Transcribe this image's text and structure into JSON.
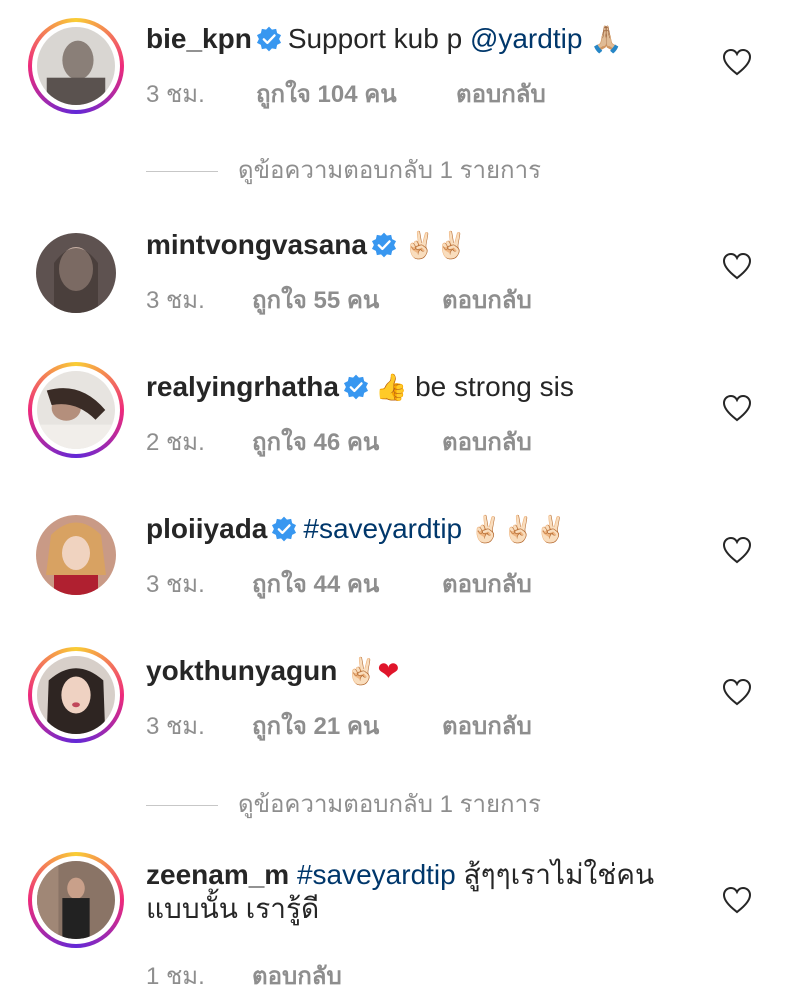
{
  "comments": [
    {
      "username": "bie_kpn",
      "verified": true,
      "text": "Support kub p ",
      "mention": "@yardtip",
      "emoji": "🙏🏼",
      "time": "3 ชม.",
      "likes": "ถูกใจ 104 คน",
      "reply": "ตอบกลับ"
    },
    {
      "username": "mintvongvasana",
      "verified": true,
      "emoji": "✌🏻✌🏻",
      "time": "3 ชม.",
      "likes": "ถูกใจ 55 คน",
      "reply": "ตอบกลับ"
    },
    {
      "username": "realyingrhatha",
      "verified": true,
      "emoji": "👍",
      "text": " be strong sis",
      "time": "2 ชม.",
      "likes": "ถูกใจ 46 คน",
      "reply": "ตอบกลับ"
    },
    {
      "username": "ploiiyada",
      "verified": true,
      "hashtag": "#saveyardtip",
      "emoji": "✌🏻✌🏻✌🏻",
      "time": "3 ชม.",
      "likes": "ถูกใจ 44 คน",
      "reply": "ตอบกลับ"
    },
    {
      "username": "yokthunyagun",
      "verified": false,
      "emoji": "✌🏻",
      "emoji2": "❤",
      "time": "3 ชม.",
      "likes": "ถูกใจ 21 คน",
      "reply": "ตอบกลับ"
    },
    {
      "username": "zeenam_m",
      "verified": false,
      "hashtag": "#saveyardtip",
      "text": " สู้ๆๆเราไม่ใช่คนแบบนั้น เรารู้ดี",
      "time": "1 ชม.",
      "reply": "ตอบกลับ"
    }
  ],
  "view_replies": [
    "ดูข้อความตอบกลับ 1 รายการ",
    "ดูข้อความตอบกลับ 1 รายการ"
  ],
  "colors": {
    "link": "#00376b",
    "muted": "#8e8e8e",
    "verified": "#3897f0"
  },
  "icons": {
    "like": "heart-outline-icon",
    "verified": "verified-badge-icon"
  }
}
